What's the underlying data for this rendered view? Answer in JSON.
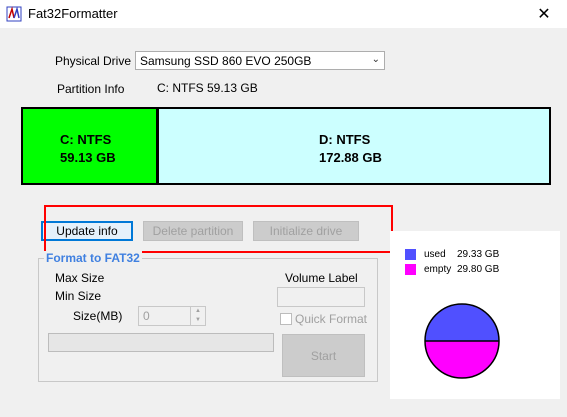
{
  "window": {
    "title": "Fat32Formatter",
    "close_glyph": "✕"
  },
  "drive": {
    "physical_drive_label": "Physical Drive",
    "physical_drive_value": "Samsung SSD 860 EVO 250GB",
    "partition_info_label": "Partition Info",
    "partition_info_value": "C: NTFS  59.13 GB"
  },
  "partitions": [
    {
      "name": "C: NTFS",
      "size": "59.13 GB",
      "color": "#00ff00"
    },
    {
      "name": "D: NTFS",
      "size": "172.88 GB",
      "color": "#ccffff"
    }
  ],
  "buttons": {
    "update_info": "Update info",
    "delete_partition": "Delete partition",
    "initialize_drive": "Initialize drive"
  },
  "format": {
    "group_title": "Format to FAT32",
    "max_size_label": "Max Size",
    "min_size_label": "Min Size",
    "size_label": "Size(MB)",
    "size_value": "0",
    "volume_label_label": "Volume Label",
    "quick_format_label": "Quick Format",
    "start_label": "Start"
  },
  "usage": {
    "used_label": "used",
    "used_value": "29.33 GB",
    "used_color": "#5050ff",
    "empty_label": "empty",
    "empty_value": "29.80 GB",
    "empty_color": "#ff00ff"
  },
  "icons": {
    "app": "fat32-app-icon",
    "close": "close-icon",
    "dropdown": "chevron-down-icon"
  }
}
